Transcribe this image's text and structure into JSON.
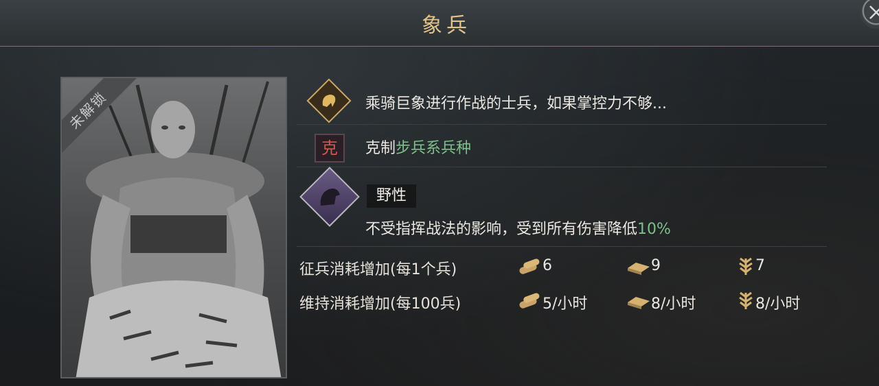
{
  "header": {
    "title": "象兵"
  },
  "portrait": {
    "lock_label": "未解锁"
  },
  "description": {
    "text": "乘骑巨象进行作战的士兵，如果掌控力不够..."
  },
  "counter": {
    "icon_char": "克",
    "prefix": "克制",
    "target": "步兵系兵种"
  },
  "trait": {
    "name": "野性",
    "text_main": "不受指挥战法的影响，受到所有伤害降低",
    "text_value": "10%"
  },
  "costs": {
    "recruit": {
      "label": "征兵消耗增加(每1个兵)",
      "wood": "6",
      "iron": "9",
      "grain": "7"
    },
    "upkeep": {
      "label": "维持消耗增加(每100兵)",
      "wood": "5/小时",
      "iron": "8/小时",
      "grain": "8/小时"
    }
  },
  "colors": {
    "accent_gold": "#e2c38a",
    "highlight_green": "#7ec08a",
    "counter_red": "#e05050"
  },
  "icons": [
    "close-icon",
    "elephant-unit-icon",
    "counter-icon",
    "horse-trait-icon",
    "wood-icon",
    "iron-icon",
    "grain-icon"
  ]
}
